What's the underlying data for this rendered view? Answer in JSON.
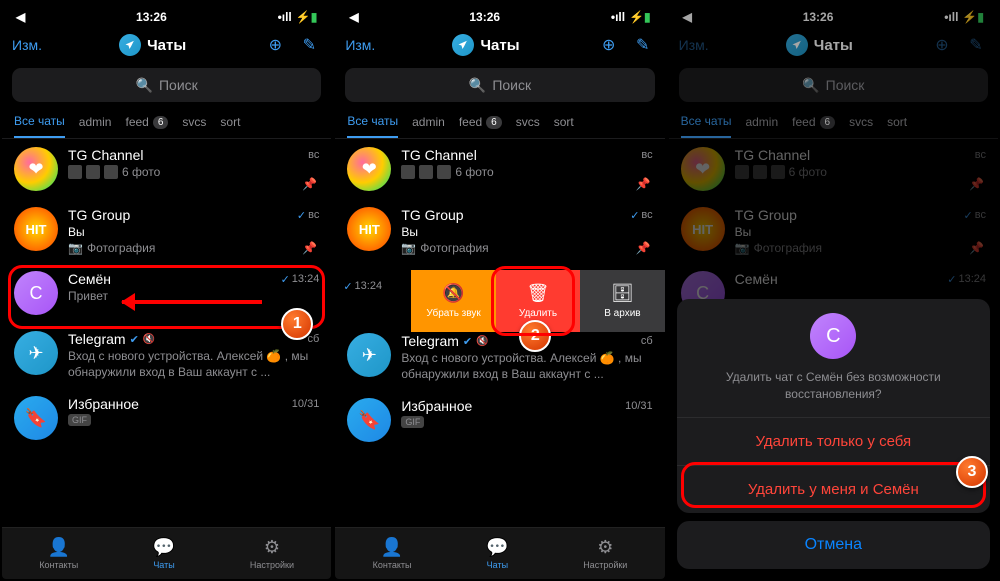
{
  "status": {
    "time": "13:26",
    "nav": "◀",
    "signal": "•ıll",
    "wifi": "⦿",
    "battery_icon": "⚡▮"
  },
  "nav": {
    "edit": "Изм.",
    "title": "Чаты",
    "new_chat_icon": "⊕",
    "compose_icon": "✎"
  },
  "search": {
    "placeholder": "Поиск"
  },
  "tabs": {
    "all": "Все чаты",
    "admin": "admin",
    "feed": "feed",
    "feed_count": "6",
    "svcs": "svcs",
    "sort": "sort"
  },
  "chats": {
    "tgchannel": {
      "name": "TG Channel",
      "time": "вс",
      "msg": "6 фото"
    },
    "tggroup": {
      "name": "TG Group",
      "time": "вс",
      "you": "Вы",
      "msg": "Фотография",
      "photo_icon": "📷"
    },
    "semyon": {
      "name": "Семён",
      "time": "13:24",
      "msg": "Привет",
      "initial": "C"
    },
    "telegram": {
      "name": "Telegram",
      "time": "сб",
      "msg": "Вход с нового устройства. Алексей 🍊 , мы обнаружили вход в Ваш аккаунт с ..."
    },
    "fav": {
      "name": "Избранное",
      "time": "10/31",
      "gif": "GIF"
    }
  },
  "avatar_text": {
    "hit": "HIT",
    "tel": "✈",
    "fav": "🔖"
  },
  "tabbar": {
    "contacts": "Контакты",
    "chats": "Чаты",
    "settings": "Настройки"
  },
  "swipe": {
    "mute": "Убрать звук",
    "delete": "Удалить",
    "archive": "В архив"
  },
  "sheet": {
    "question": "Удалить чат с Семён без возможности восстановления?",
    "self_only": "Удалить только у себя",
    "both": "Удалить у меня и Семён",
    "cancel": "Отмена"
  },
  "steps": {
    "1": "1",
    "2": "2",
    "3": "3"
  }
}
